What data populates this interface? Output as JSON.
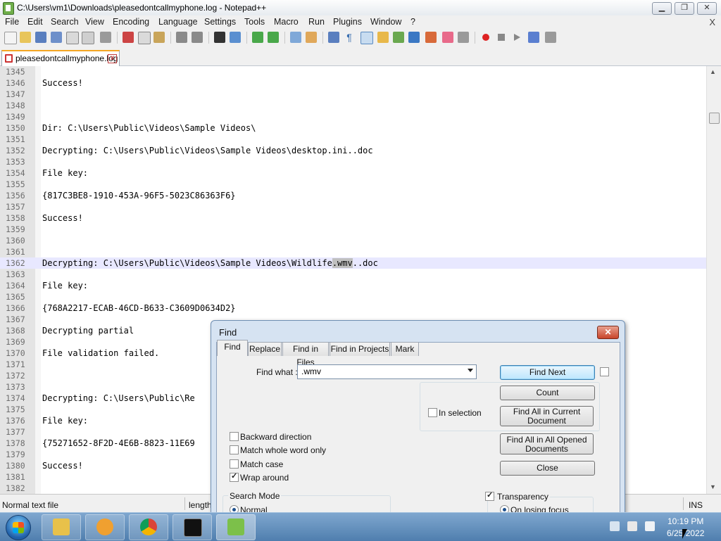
{
  "window": {
    "title": "C:\\Users\\vm1\\Downloads\\pleasedontcallmyphone.log - Notepad++",
    "minimize_label": "▁",
    "maximize_label": "❐",
    "close_label": "✕"
  },
  "menubar": {
    "items": [
      "File",
      "Edit",
      "Search",
      "View",
      "Encoding",
      "Language",
      "Settings",
      "Tools",
      "Macro",
      "Run",
      "Plugins",
      "Window",
      "?"
    ],
    "close_label": "X"
  },
  "tabbar": {
    "active_tab": "pleasedontcallmyphone.log",
    "close_label": "x"
  },
  "editor": {
    "lines": [
      {
        "num": "1345",
        "text": ""
      },
      {
        "num": "1346",
        "text": "Success!"
      },
      {
        "num": "1347",
        "text": ""
      },
      {
        "num": "1348",
        "text": ""
      },
      {
        "num": "1349",
        "text": ""
      },
      {
        "num": "1350",
        "text": "Dir: C:\\Users\\Public\\Videos\\Sample Videos\\"
      },
      {
        "num": "1351",
        "text": ""
      },
      {
        "num": "1352",
        "text": "Decrypting: C:\\Users\\Public\\Videos\\Sample Videos\\desktop.ini..doc"
      },
      {
        "num": "1353",
        "text": ""
      },
      {
        "num": "1354",
        "text": "File key:"
      },
      {
        "num": "1355",
        "text": ""
      },
      {
        "num": "1356",
        "text": "{817C3BE8-1910-453A-96F5-5023C86363F6}"
      },
      {
        "num": "1357",
        "text": ""
      },
      {
        "num": "1358",
        "text": "Success!"
      },
      {
        "num": "1359",
        "text": ""
      },
      {
        "num": "1360",
        "text": ""
      },
      {
        "num": "1361",
        "text": ""
      },
      {
        "num": "1362",
        "text_before": "Decrypting: C:\\Users\\Public\\Videos\\Sample Videos\\Wildlife",
        "text_match": ".wmv",
        "text_after": "..doc"
      },
      {
        "num": "1363",
        "text": ""
      },
      {
        "num": "1364",
        "text": "File key:"
      },
      {
        "num": "1365",
        "text": ""
      },
      {
        "num": "1366",
        "text": "{768A2217-ECAB-46CD-B633-C3609D0634D2}"
      },
      {
        "num": "1367",
        "text": ""
      },
      {
        "num": "1368",
        "text": "Decrypting partial"
      },
      {
        "num": "1369",
        "text": ""
      },
      {
        "num": "1370",
        "text": "File validation failed."
      },
      {
        "num": "1371",
        "text": ""
      },
      {
        "num": "1372",
        "text": ""
      },
      {
        "num": "1373",
        "text": ""
      },
      {
        "num": "1374",
        "text": "Decrypting: C:\\Users\\Public\\Re"
      },
      {
        "num": "1375",
        "text": ""
      },
      {
        "num": "1376",
        "text": "File key:"
      },
      {
        "num": "1377",
        "text": ""
      },
      {
        "num": "1378",
        "text": "{75271652-8F2D-4E6B-8823-11E69"
      },
      {
        "num": "1379",
        "text": ""
      },
      {
        "num": "1380",
        "text": "Success!"
      },
      {
        "num": "1381",
        "text": ""
      },
      {
        "num": "1382",
        "text": ""
      }
    ]
  },
  "statusbar": {
    "file_type": "Normal text file",
    "length_label": "length",
    "insert_mode": "INS"
  },
  "find_dialog": {
    "title": "Find",
    "tabs": [
      "Find",
      "Replace",
      "Find in Files",
      "Find in Projects",
      "Mark"
    ],
    "find_what_label": "Find what :",
    "find_what_value": ".wmv",
    "buttons": {
      "find_next": "Find Next",
      "count": "Count",
      "find_all_current": "Find All in Current Document",
      "find_all_opened": "Find All in All Opened Documents",
      "close": "Close"
    },
    "in_selection": "In selection",
    "options": {
      "backward": "Backward direction",
      "whole_word": "Match whole word only",
      "match_case": "Match case",
      "wrap_around": "Wrap around"
    },
    "search_mode_label": "Search Mode",
    "search_mode_normal": "Normal",
    "transparency_label": "Transparency",
    "transparency_option": "On losing focus"
  },
  "taskbar": {
    "time": "10:19 PM",
    "date": "6/25/2022"
  },
  "colors": {
    "current_line": "#e8e8ff",
    "match_highlight": "#c0c0c0",
    "tab_accent": "#f5a623",
    "dialog_close": "#c8442a"
  }
}
